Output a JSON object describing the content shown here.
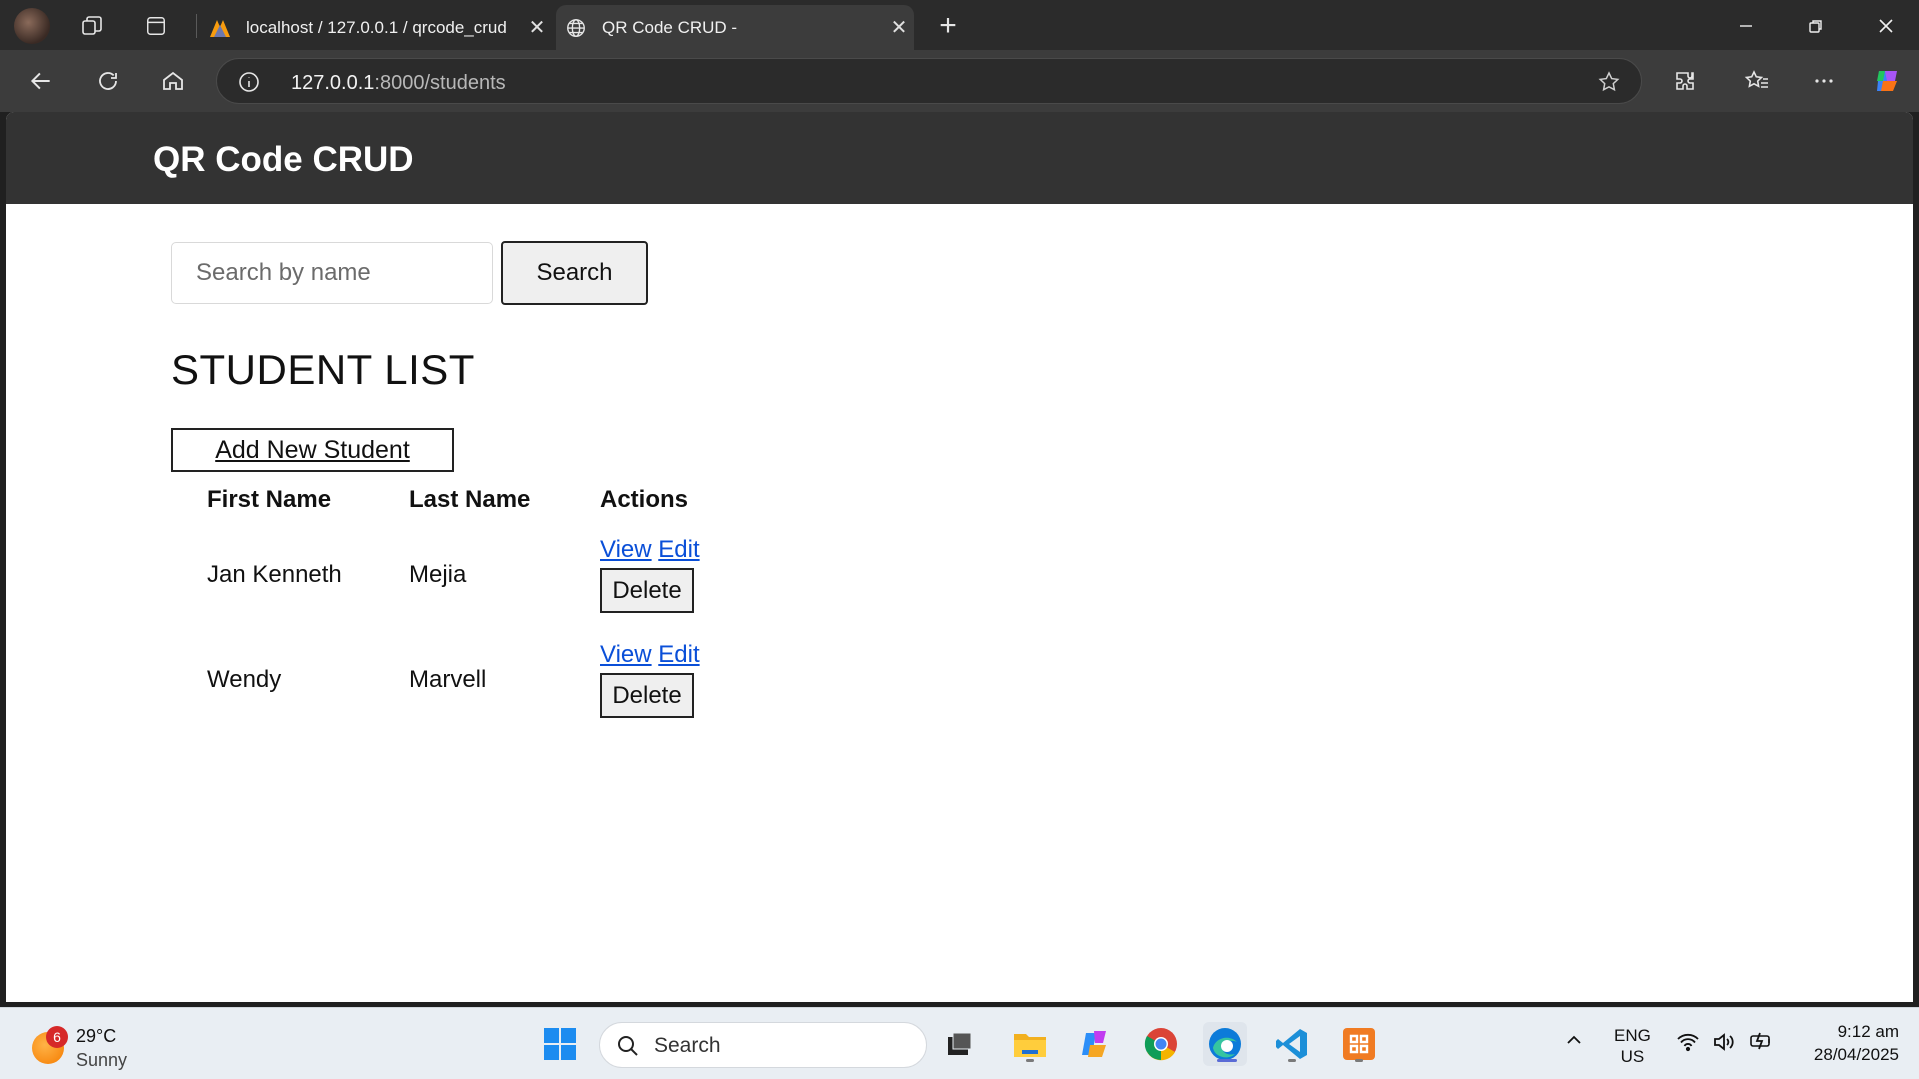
{
  "browser": {
    "tabs": [
      {
        "title": "localhost / 127.0.0.1 / qrcode_crud",
        "active": false
      },
      {
        "title": "QR Code CRUD -",
        "active": true
      }
    ],
    "url_host": "127.0.0.1",
    "url_rest": ":8000/students"
  },
  "page": {
    "site_title": "QR Code CRUD",
    "search_placeholder": "Search by name",
    "search_button": "Search",
    "list_title": "STUDENT LIST",
    "add_button": "Add New Student",
    "columns": [
      "First Name",
      "Last Name",
      "Actions"
    ],
    "students": [
      {
        "first_name": "Jan Kenneth",
        "last_name": "Mejia"
      },
      {
        "first_name": "Wendy",
        "last_name": "Marvell"
      }
    ],
    "action_view": "View",
    "action_edit": "Edit",
    "action_delete": "Delete"
  },
  "taskbar": {
    "weather_badge": "6",
    "temperature": "29°C",
    "condition": "Sunny",
    "search_label": "Search",
    "lang_top": "ENG",
    "lang_bottom": "US",
    "time": "9:12 am",
    "date": "28/04/2025"
  },
  "colors": {
    "header_bg": "#333333",
    "link": "#0a4fd8",
    "chrome_bg": "#2b2b2b"
  }
}
